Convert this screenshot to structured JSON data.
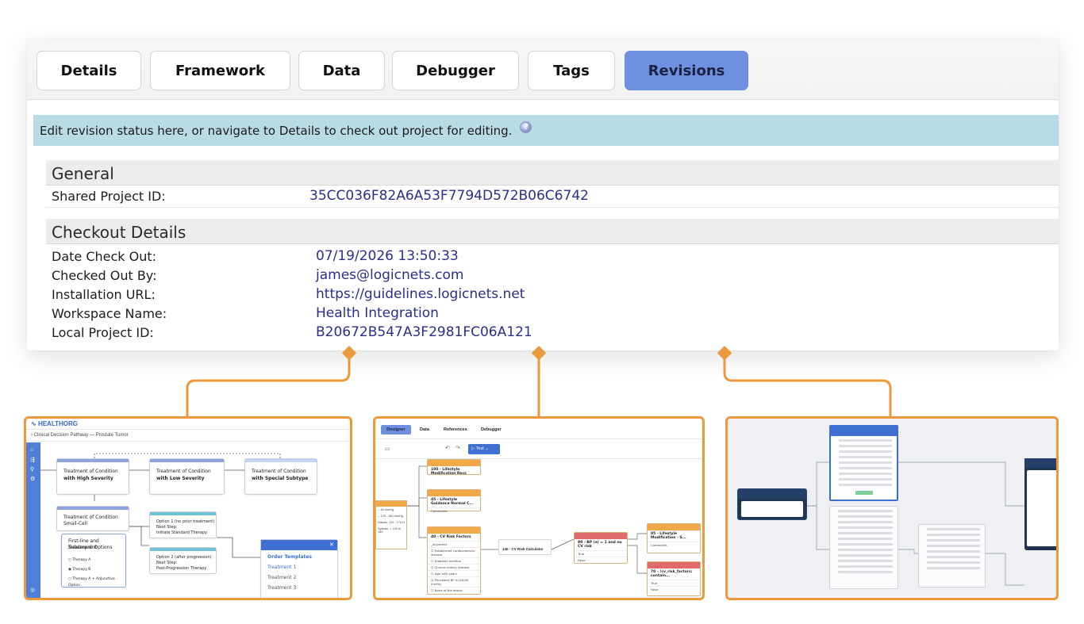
{
  "tabs": [
    {
      "label": "Details",
      "active": false
    },
    {
      "label": "Framework",
      "active": false
    },
    {
      "label": "Data",
      "active": false
    },
    {
      "label": "Debugger",
      "active": false
    },
    {
      "label": "Tags",
      "active": false
    },
    {
      "label": "Revisions",
      "active": true
    }
  ],
  "banner": {
    "text": "Edit revision status here, or navigate to Details to check out project for editing."
  },
  "general": {
    "heading": "General",
    "shared_project_id_label": "Shared Project ID:",
    "shared_project_id_value": "35CC036F82A6A53F7794D572B06C6742"
  },
  "checkout": {
    "heading": "Checkout Details",
    "rows": [
      {
        "label": "Date Check Out:",
        "value": "07/19/2026 13:50:33"
      },
      {
        "label": "Checked Out By:",
        "value": "james@logicnets.com"
      },
      {
        "label": "Installation URL:",
        "value": "https://guidelines.logicnets.net"
      },
      {
        "label": "Workspace Name:",
        "value": "Health Integration"
      },
      {
        "label": "Local Project ID:",
        "value": "B20672B547A3F2981FC06A121"
      }
    ]
  },
  "colors": {
    "accent": "#6f8fe0",
    "connector": "#ea9a3c",
    "banner": "#b9dbe6",
    "value_text": "#2b2f8a"
  },
  "thumb1": {
    "brand": "HEALTHORG",
    "breadcrumb": "Clinical Decision Pathway — Prostate Tumor",
    "nodes": [
      {
        "line1": "Treatment of Condition",
        "line2": "with High Severity"
      },
      {
        "line1": "Treatment of Condition",
        "line2": "with Low Severity"
      },
      {
        "line1": "Treatment of Condition",
        "line2": "with Special Subtype"
      },
      {
        "line1": "Treatment of Condition",
        "line2": "Small-Cell"
      }
    ],
    "first_line": {
      "title1": "First-line and Subsequent",
      "title2": "Treatment Options",
      "options": [
        "Therapy A",
        "Therapy B",
        "Therapy A + Adjunctive Option"
      ]
    },
    "option1": {
      "l1": "Option 1 (no prior treatment)",
      "l2": "Next Step:",
      "l3": "Initiate Standard Therapy"
    },
    "option2": {
      "l1": "Option 2 (after progression)",
      "l2": "Next Step:",
      "l3": "Post-Progression Therapy"
    },
    "templates": {
      "title": "Order Templates",
      "items": [
        "Treatment 1",
        "Treatment 2",
        "Treatment 3"
      ]
    }
  },
  "thumb2": {
    "tabs": [
      "Designer",
      "Data",
      "References",
      "Debugger"
    ],
    "test_label": "Test",
    "cards": [
      {
        "title": "100 - Lifestyle Modification Recs"
      },
      {
        "title": "45 - Lifestyle Guidance Normal C..."
      },
      {
        "title": "40 - CV Risk Factors",
        "lines": [
          "_Anyselect",
          "Established cardiovascular disease",
          "Diabetes mellitus",
          "Chronic kidney disease",
          "Age ≥65 years",
          "Persistent BP ≥140/90 mmHg",
          "None of the above"
        ]
      },
      {
        "title": "140 - CV Risk Calculator"
      },
      {
        "title": "90 - BP (a) = 1 and no CV risk",
        "lines": [
          "True",
          "False"
        ]
      },
      {
        "title": "85 - Lifestyle Modification - S...",
        "lines": [
          "Comments"
        ]
      },
      {
        "title": "70 - !cv_risk_factors: contain...",
        "lines": [
          "True",
          "False"
        ]
      }
    ],
    "left_stub": [
      "-- 60 mmHg",
      "-- 125 - 160 mmHg",
      "Distolic: 110 - 170 H",
      "Systolic: > 140 to 159"
    ],
    "comments_label": "Comments"
  }
}
